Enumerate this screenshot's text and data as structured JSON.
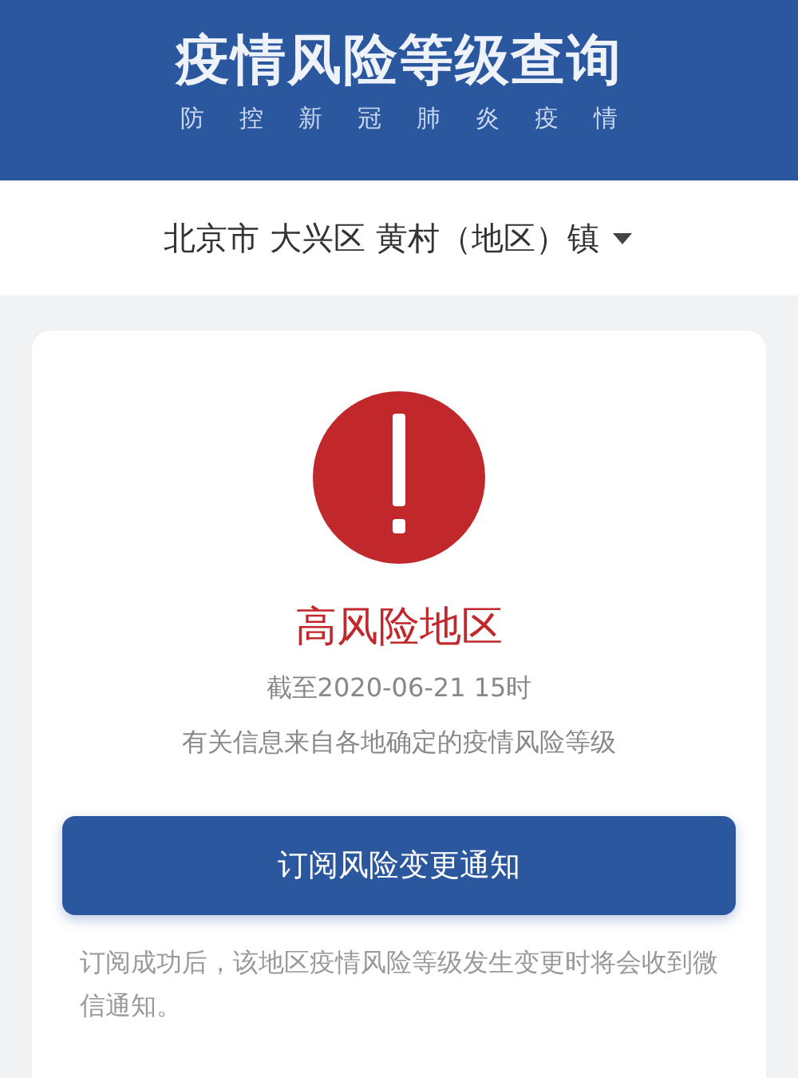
{
  "header": {
    "title": "疫情风险等级查询",
    "subtitle": "防控新冠肺炎疫情"
  },
  "location": {
    "text": "北京市 大兴区 黄村（地区）镇",
    "expanded": false
  },
  "result": {
    "kind": "high",
    "level_label": "高风险地区",
    "updated": "截至2020-06-21 15时",
    "source": "有关信息来自各地确定的疫情风险等级"
  },
  "subscribe_button": "订阅风险变更通知",
  "note": "订阅成功后，该地区疫情风险等级发生变更时将会收到微信通知。"
}
